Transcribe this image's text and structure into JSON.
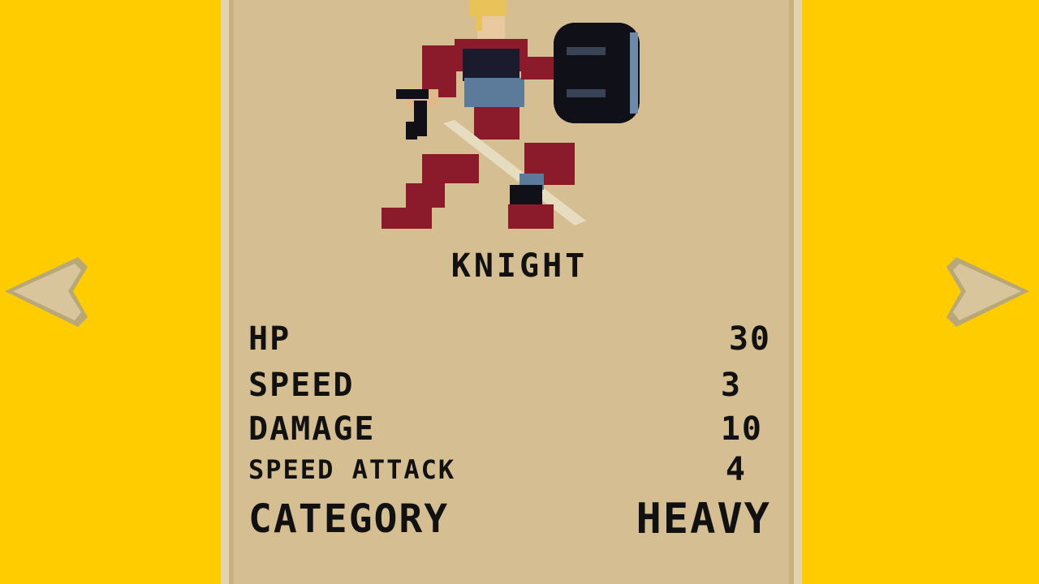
{
  "character": {
    "name": "KNIGHT",
    "portrait_icon": "knight-sprite"
  },
  "stats": [
    {
      "label": "HP",
      "value": "30"
    },
    {
      "label": "SPEED",
      "value": "3"
    },
    {
      "label": "DAMAGE",
      "value": "10"
    },
    {
      "label": "SPEED ATTACK",
      "value": "4"
    },
    {
      "label": "CATEGORY",
      "value": "HEAVY"
    }
  ],
  "navigation": {
    "prev_icon": "arrow-left-icon",
    "next_icon": "arrow-right-icon"
  },
  "colors": {
    "background": "#FFCC00",
    "card": "#D4BE92",
    "card_border": "#E2D4AE",
    "text": "#111111"
  }
}
